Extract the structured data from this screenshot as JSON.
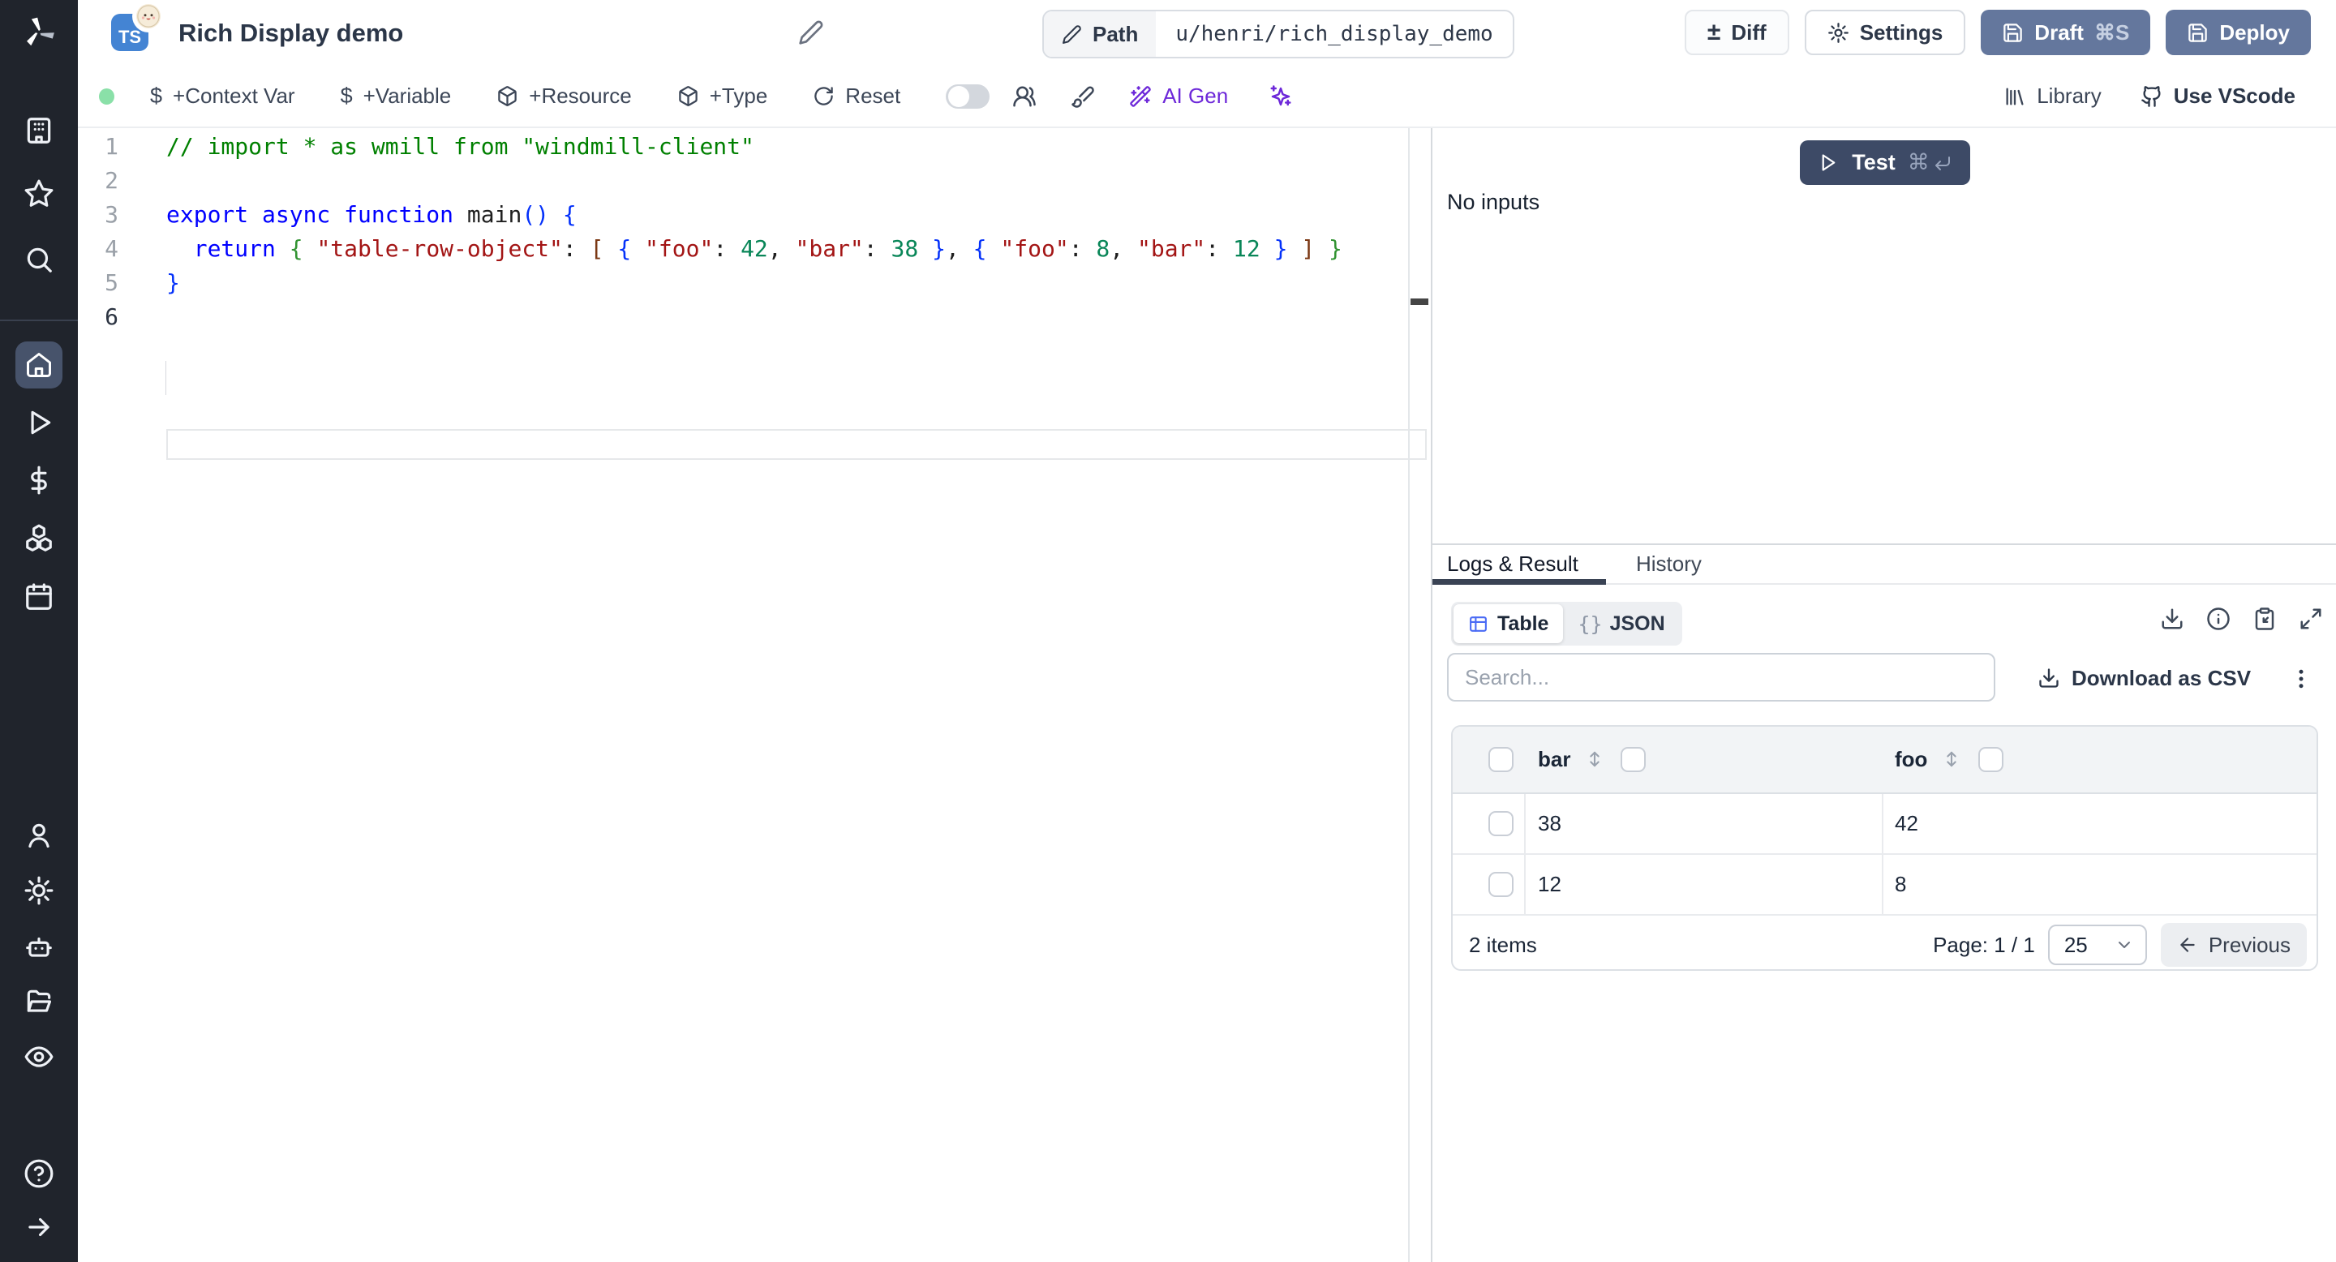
{
  "header": {
    "lang_badge": "TS",
    "title": "Rich Display demo",
    "path_label": "Path",
    "path_value": "u/henri/rich_display_demo",
    "diff_label": "Diff",
    "settings_label": "Settings",
    "draft_label": "Draft",
    "draft_shortcut": "⌘S",
    "deploy_label": "Deploy"
  },
  "icons": {
    "plus_minus": "±",
    "dollar": "$",
    "command": "⌘",
    "braces": "{}"
  },
  "toolbar": {
    "context_var_label": "+Context Var",
    "variable_label": "+Variable",
    "resource_label": "+Resource",
    "type_label": "+Type",
    "reset_label": "Reset",
    "ai_gen_label": "AI Gen",
    "library_label": "Library",
    "vscode_label": "Use VScode",
    "status_dot_color": "#8ae0a8",
    "ai_accent_color": "#6d28d9"
  },
  "editor": {
    "language": "typescript",
    "active_line": 6,
    "lines": [
      [
        [
          "com",
          "// import * as wmill from \"windmill-client\""
        ]
      ],
      [],
      [
        [
          "kw",
          "export async function"
        ],
        [
          "pl",
          " "
        ],
        [
          "fn",
          "main"
        ],
        [
          "b1",
          "()"
        ],
        [
          "pl",
          " "
        ],
        [
          "b1",
          "{"
        ]
      ],
      [
        [
          "pl",
          "  "
        ],
        [
          "kw",
          "return"
        ],
        [
          "pl",
          " "
        ],
        [
          "b2",
          "{"
        ],
        [
          "pl",
          " "
        ],
        [
          "str",
          "\"table-row-object\""
        ],
        [
          "pl",
          ": "
        ],
        [
          "b3",
          "["
        ],
        [
          "pl",
          " "
        ],
        [
          "b1",
          "{"
        ],
        [
          "pl",
          " "
        ],
        [
          "str",
          "\"foo\""
        ],
        [
          "pl",
          ": "
        ],
        [
          "num",
          "42"
        ],
        [
          "pl",
          ", "
        ],
        [
          "str",
          "\"bar\""
        ],
        [
          "pl",
          ": "
        ],
        [
          "num",
          "38"
        ],
        [
          "pl",
          " "
        ],
        [
          "b1",
          "}"
        ],
        [
          "pl",
          ", "
        ],
        [
          "b1",
          "{"
        ],
        [
          "pl",
          " "
        ],
        [
          "str",
          "\"foo\""
        ],
        [
          "pl",
          ": "
        ],
        [
          "num",
          "8"
        ],
        [
          "pl",
          ", "
        ],
        [
          "str",
          "\"bar\""
        ],
        [
          "pl",
          ": "
        ],
        [
          "num",
          "12"
        ],
        [
          "pl",
          " "
        ],
        [
          "b1",
          "}"
        ],
        [
          "pl",
          " "
        ],
        [
          "b3",
          "]"
        ],
        [
          "pl",
          " "
        ],
        [
          "b2",
          "}"
        ]
      ],
      [
        [
          "b1",
          "}"
        ]
      ],
      []
    ]
  },
  "run_panel": {
    "test_label": "Test",
    "no_inputs_label": "No inputs",
    "tabs": [
      {
        "label": "Logs & Result"
      },
      {
        "label": "History"
      }
    ],
    "view_toggle": {
      "table_label": "Table",
      "json_label": "JSON"
    },
    "search_placeholder": "Search...",
    "download_csv_label": "Download as CSV",
    "table": {
      "columns": [
        "bar",
        "foo"
      ],
      "rows": [
        [
          "38",
          "42"
        ],
        [
          "12",
          "8"
        ]
      ],
      "items_count_label": "2 items",
      "page_label": "Page: 1 / 1",
      "page_size": "25",
      "previous_label": "Previous"
    }
  }
}
